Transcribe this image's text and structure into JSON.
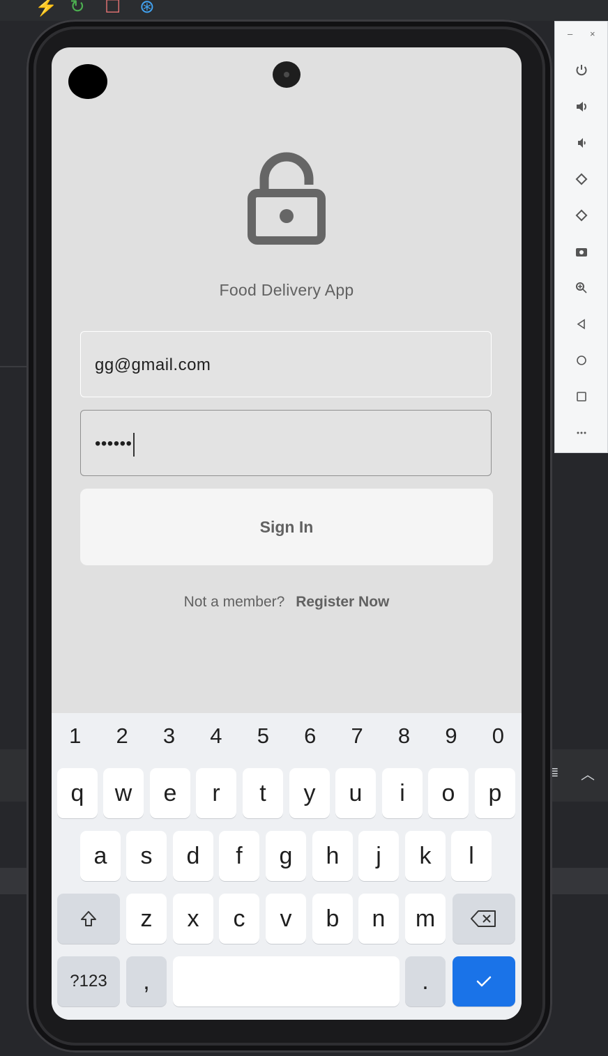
{
  "app": {
    "title": "Food Delivery App",
    "email_value": "gg@gmail.com",
    "password_value": "••••••",
    "signin_label": "Sign In",
    "register_prompt": "Not a member?",
    "register_link": "Register Now"
  },
  "keyboard": {
    "numbers": [
      "1",
      "2",
      "3",
      "4",
      "5",
      "6",
      "7",
      "8",
      "9",
      "0"
    ],
    "row1": [
      "q",
      "w",
      "e",
      "r",
      "t",
      "y",
      "u",
      "i",
      "o",
      "p"
    ],
    "row2": [
      "a",
      "s",
      "d",
      "f",
      "g",
      "h",
      "j",
      "k",
      "l"
    ],
    "row3": [
      "z",
      "x",
      "c",
      "v",
      "b",
      "n",
      "m"
    ],
    "symbols_label": "?123",
    "comma_label": ",",
    "period_label": "."
  },
  "emulator_toolbar": {
    "minimize": "–",
    "close": "×",
    "tools": [
      "power-icon",
      "volume-up-icon",
      "volume-down-icon",
      "rotate-left-icon",
      "rotate-right-icon",
      "screenshot-icon",
      "zoom-icon",
      "back-icon",
      "home-icon",
      "overview-icon",
      "more-icon"
    ]
  },
  "colors": {
    "screen_bg": "#e0e0e0",
    "text_gray": "#616161",
    "accent_blue": "#1a73e8"
  }
}
